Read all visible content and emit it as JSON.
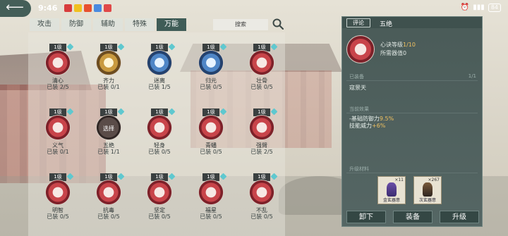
{
  "status": {
    "time": "9:46",
    "battery": "84"
  },
  "tabs": [
    "攻击",
    "防御",
    "辅助",
    "特殊",
    "万能"
  ],
  "active_tab": "万能",
  "search": {
    "placeholder": "搜索"
  },
  "skills": [
    {
      "level": "1级",
      "name": "清心",
      "equip": "已装 2/5",
      "style": "red"
    },
    {
      "level": "1级",
      "name": "齐力",
      "equip": "已装 0/1",
      "style": "gold"
    },
    {
      "level": "1级",
      "name": "迷离",
      "equip": "已装 1/5",
      "style": "blue"
    },
    {
      "level": "1级",
      "name": "归元",
      "equip": "已装 0/5",
      "style": "blue"
    },
    {
      "level": "1级",
      "name": "壮骨",
      "equip": "已装 0/5",
      "style": "red"
    },
    {
      "level": "1级",
      "name": "义气",
      "equip": "已装 0/1",
      "style": "red"
    },
    {
      "level": "1级",
      "name": "五绝",
      "equip": "已装 1/1",
      "style": "dark",
      "overlay": "选择"
    },
    {
      "level": "1级",
      "name": "轻身",
      "equip": "已装 0/5",
      "style": "red"
    },
    {
      "level": "1级",
      "name": "青蟠",
      "equip": "已装 0/5",
      "style": "red"
    },
    {
      "level": "1级",
      "name": "强臂",
      "equip": "已装 2/5",
      "style": "red"
    },
    {
      "level": "1级",
      "name": "明智",
      "equip": "已装 0/5",
      "style": "red"
    },
    {
      "level": "1级",
      "name": "抗毒",
      "equip": "已装 0/5",
      "style": "red"
    },
    {
      "level": "1级",
      "name": "坚定",
      "equip": "已装 0/5",
      "style": "red"
    },
    {
      "level": "1级",
      "name": "福星",
      "equip": "已装 0/5",
      "style": "red"
    },
    {
      "level": "1级",
      "name": "不乱",
      "equip": "已装 0/5",
      "style": "red"
    }
  ],
  "detail": {
    "comment_label": "评论",
    "title": "五绝",
    "level_label": "心诀等级",
    "level_value": "1/10",
    "need_label": "所需器值",
    "need_value": "0",
    "equipped_label": "已装备",
    "equipped_count": "1/1",
    "equipped_item": "寇景天",
    "effect_label": "当前效果",
    "effects": [
      {
        "label": "-基础防御力",
        "value": "9.5%"
      },
      {
        "label": "技能威力",
        "value": "+6%"
      }
    ],
    "material_label": "升级材料",
    "materials": [
      {
        "name": "金玄器意",
        "qty": "×11"
      },
      {
        "name": "次玄器意",
        "qty": "×267"
      }
    ],
    "buttons": {
      "unequip": "卸下",
      "equip": "装备",
      "upgrade": "升级"
    }
  },
  "colors": {
    "panel": "#4a5b58",
    "active_tab": "#3f5c57",
    "highlight": "#f0c060"
  }
}
